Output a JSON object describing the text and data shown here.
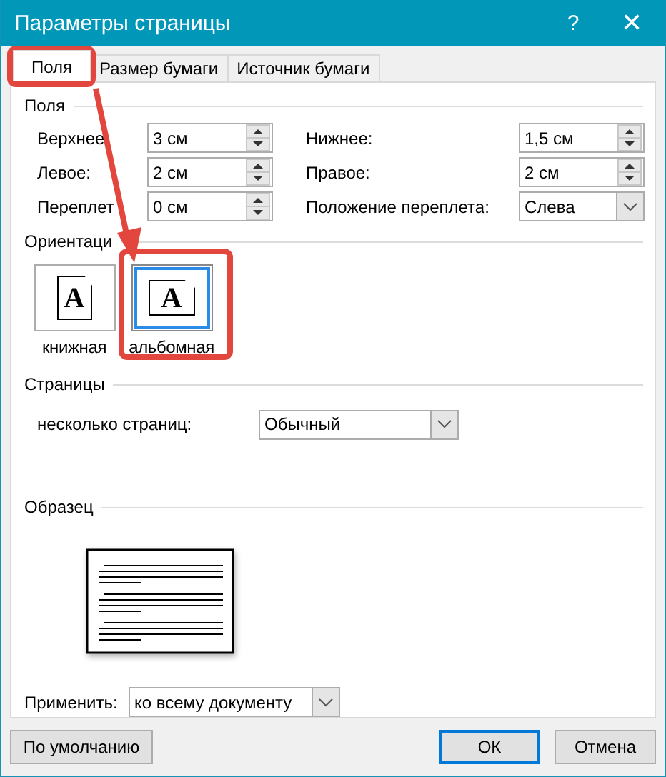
{
  "window": {
    "title": "Параметры страницы",
    "help": "?",
    "close": "✕"
  },
  "tabs": [
    {
      "label": "Поля",
      "selected": true
    },
    {
      "label": "Размер бумаги",
      "selected": false
    },
    {
      "label": "Источник бумаги",
      "selected": false
    }
  ],
  "margins": {
    "title": "Поля",
    "fields": [
      {
        "label": "Верхнее",
        "value": "3 см",
        "kind": "spin"
      },
      {
        "label": "Нижнее:",
        "value": "1,5 см",
        "kind": "spin"
      },
      {
        "label": "Левое:",
        "value": "2 см",
        "kind": "spin"
      },
      {
        "label": "Правое:",
        "value": "2 см",
        "kind": "spin"
      },
      {
        "label": "Переплет",
        "value": "0 см",
        "kind": "spin"
      },
      {
        "label": "Положение переплета:",
        "value": "Слева",
        "kind": "select"
      }
    ]
  },
  "orientation": {
    "title": "Ориентаци",
    "options": [
      {
        "label": "книжная",
        "kind": "portrait",
        "glyph": "A",
        "selected": false
      },
      {
        "label": "альбомная",
        "kind": "landscape",
        "glyph": "A",
        "selected": true
      }
    ]
  },
  "pages": {
    "title": "Страницы",
    "label": "несколько страниц:",
    "value": "Обычный"
  },
  "preview": {
    "title": "Образец"
  },
  "apply": {
    "label": "Применить:",
    "value": "ко всему документу"
  },
  "buttons": [
    {
      "label": "По умолчанию",
      "default": false
    },
    {
      "label": "ОК",
      "default": true
    },
    {
      "label": "Отмена",
      "default": false
    }
  ]
}
